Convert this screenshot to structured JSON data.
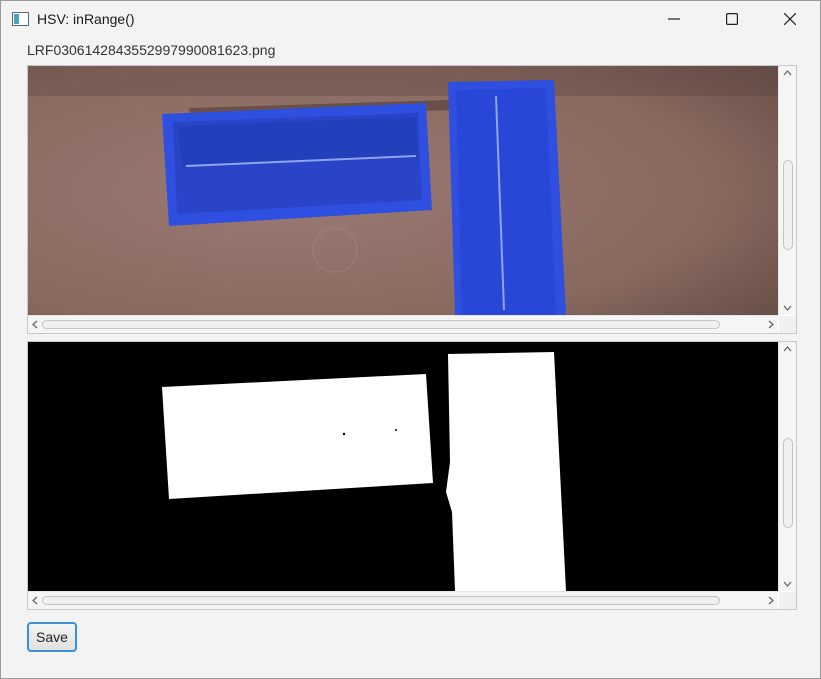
{
  "window": {
    "title": "HSV: inRange()",
    "minimize_icon": "minimize-icon",
    "maximize_icon": "maximize-icon",
    "close_icon": "close-icon"
  },
  "filename": "LRF03061428435529979900816​23.png",
  "panes": {
    "original": {
      "description_icon": "photo",
      "vscroll_position": 0.38,
      "hscroll_position": 0.0
    },
    "mask": {
      "description_icon": "binary-mask",
      "vscroll_position": 0.4,
      "hscroll_position": 0.0
    }
  },
  "save_button": {
    "label": "Save"
  },
  "colors": {
    "accent": "#3b8fd6",
    "floor": "#8c6f6a",
    "box_blue": "#2f4fe0",
    "mask_fg": "#ffffff",
    "mask_bg": "#000000"
  }
}
